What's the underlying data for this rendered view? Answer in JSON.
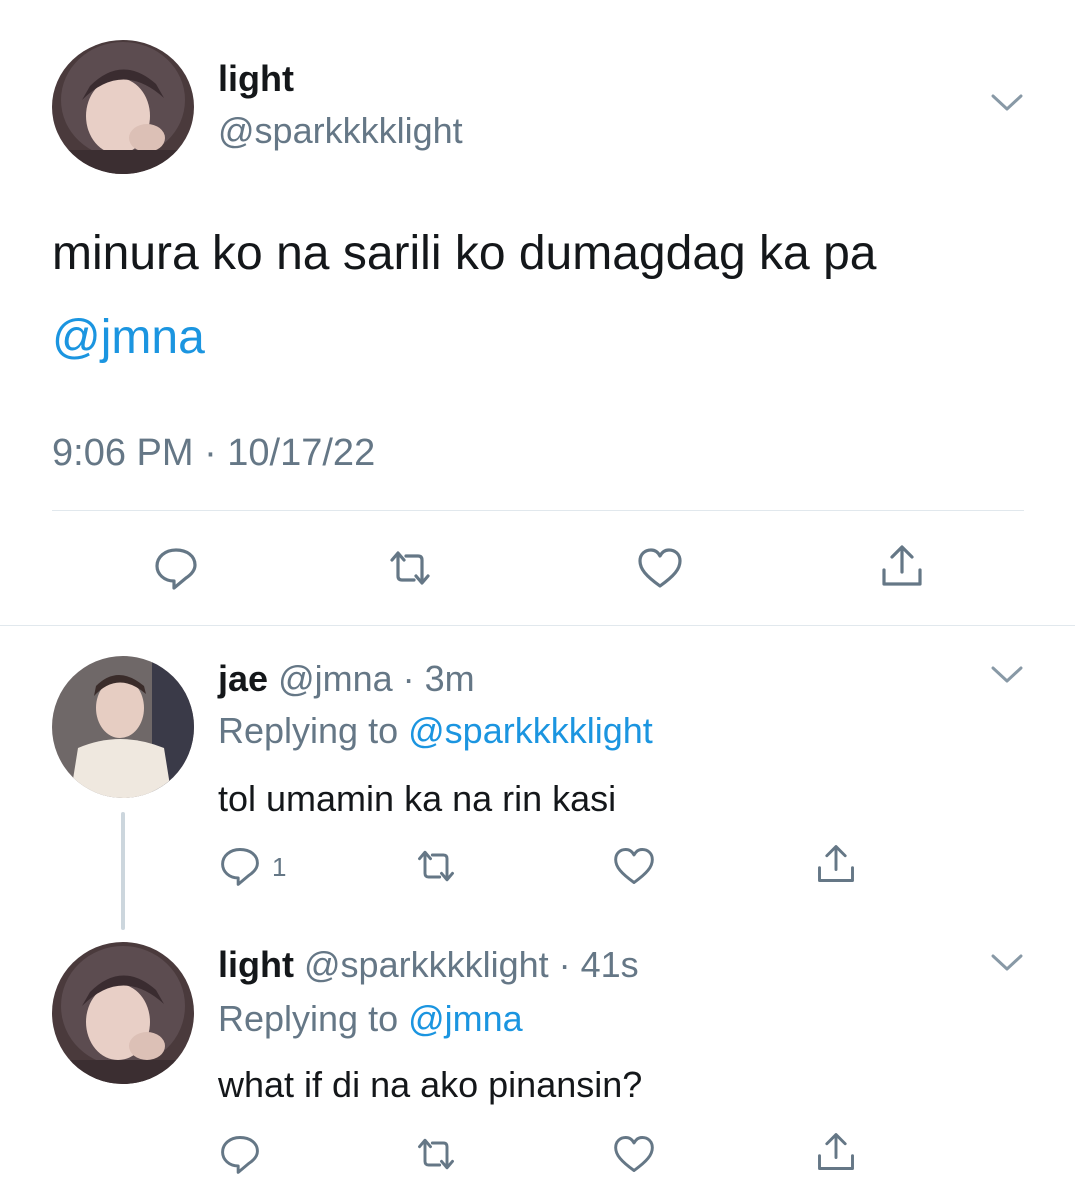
{
  "main_tweet": {
    "display_name": "light",
    "handle": "@sparkkkklight",
    "text": "minura ko na sarili ko dumagdag ka pa",
    "mention": "@jmna",
    "timestamp": "9:06 PM · 10/17/22",
    "actions": {
      "reply_icon": "reply-icon",
      "retweet_icon": "retweet-icon",
      "like_icon": "heart-icon",
      "share_icon": "share-icon"
    }
  },
  "replies": [
    {
      "display_name": "jae",
      "handle": "@jmna",
      "time": "3m",
      "replying_prefix": "Replying to",
      "replying_to": "@sparkkkklight",
      "text": "tol umamin ka na rin kasi",
      "reply_count": "1"
    },
    {
      "display_name": "light",
      "handle": "@sparkkkklight",
      "time": "41s",
      "replying_prefix": "Replying to",
      "replying_to": "@jmna",
      "text": "what if di na ako pinansin?",
      "reply_count": ""
    }
  ],
  "colors": {
    "link": "#1b95e0",
    "secondary": "#657786",
    "divider": "#e1e8ed",
    "icon": "#657786"
  }
}
